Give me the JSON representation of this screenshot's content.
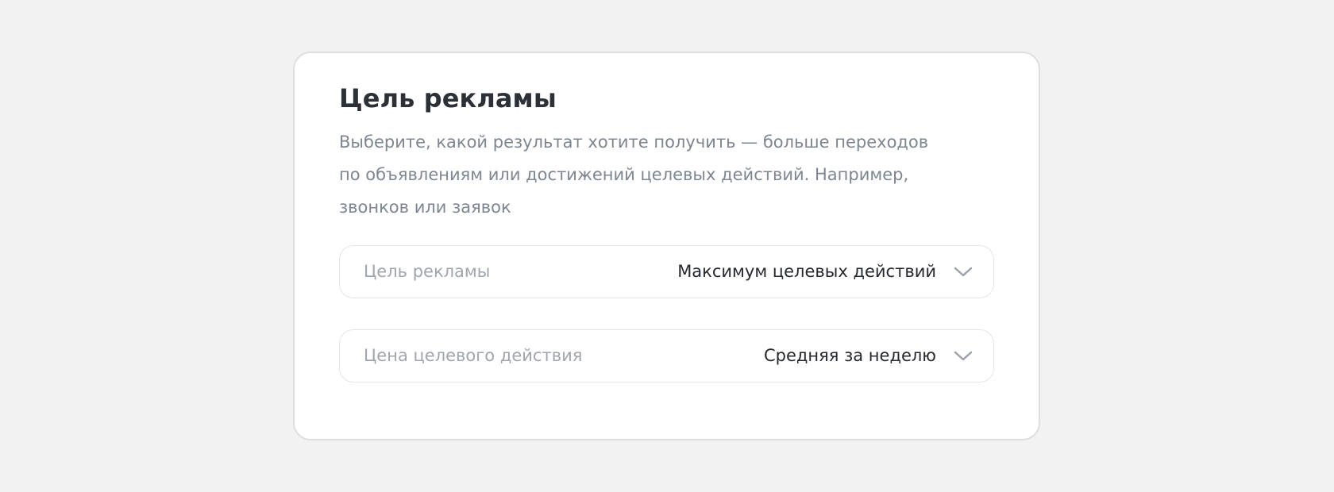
{
  "card": {
    "title": "Цель рекламы",
    "description_lines": [
      "Выберите, какой результат хотите получить — больше переходов",
      "по объявлениям или достижений целевых действий. Например,",
      "звонков или заявок"
    ]
  },
  "fields": [
    {
      "label": "Цель рекламы",
      "value": "Максимум целевых действий",
      "icon": "chevron-down-icon"
    },
    {
      "label": "Цена целевого действия",
      "value": "Средняя за неделю",
      "icon": "chevron-down-icon"
    }
  ],
  "colors": {
    "page_background": "#f2f2f2",
    "card_background": "#ffffff",
    "card_border": "#dedede",
    "title": "#2c3138",
    "description": "#7d8691",
    "field_label": "#a0a6ae",
    "field_value": "#25292f",
    "chevron": "#9aa1ab"
  }
}
